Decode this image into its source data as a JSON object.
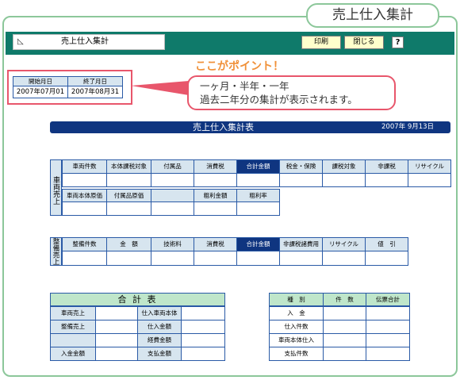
{
  "tab_title": "売上仕入集計",
  "window": {
    "app_name": "売上仕入集計",
    "print_label": "印刷",
    "close_label": "閉じる",
    "help_label": "?"
  },
  "period": {
    "start_header": "開始月日",
    "end_header": "終了月日",
    "start_value": "2007年07月01",
    "end_value": "2007年08月31"
  },
  "callout": {
    "title": "ここがポイント！",
    "line1": "一ヶ月・半年・一年",
    "line2": "過去二年分の集計が表示されます。"
  },
  "main": {
    "title": "売上仕入集計表",
    "date": "2007年 9月13日"
  },
  "vehicle_sales": {
    "label": "車両売上",
    "row1_headers": [
      "車両件数",
      "本体課税対象",
      "付属品",
      "消費税",
      "合計金額",
      "税金・保険",
      "課税対象",
      "非課税",
      "リサイクル"
    ],
    "row2_headers": [
      "車両本体原価",
      "付属品原価",
      "",
      "粗利金額",
      "粗利率"
    ]
  },
  "maintenance_sales": {
    "label": "整備売上",
    "headers": [
      "整備件数",
      "金　額",
      "技術料",
      "消費税",
      "合計金額",
      "非課税諸費用",
      "リサイクル",
      "値　引"
    ]
  },
  "totals": {
    "title": "合 計 表",
    "rows": [
      [
        "車両売上",
        "仕入車両本体"
      ],
      [
        "整備売上",
        "仕入金額"
      ],
      [
        "",
        "経費金額"
      ],
      [
        "入金金額",
        "支払金額"
      ]
    ]
  },
  "kind_table": {
    "headers": [
      "種　別",
      "件　数",
      "伝票合計"
    ],
    "rows": [
      "入　金",
      "仕入件数",
      "車両本体仕入",
      "支払件数"
    ]
  },
  "colors": {
    "frame": "#8cc79a",
    "topbar": "#0f7a6a",
    "header_blue": "#0f3580",
    "accent_red": "#e8566b",
    "accent_orange": "#f09038"
  }
}
